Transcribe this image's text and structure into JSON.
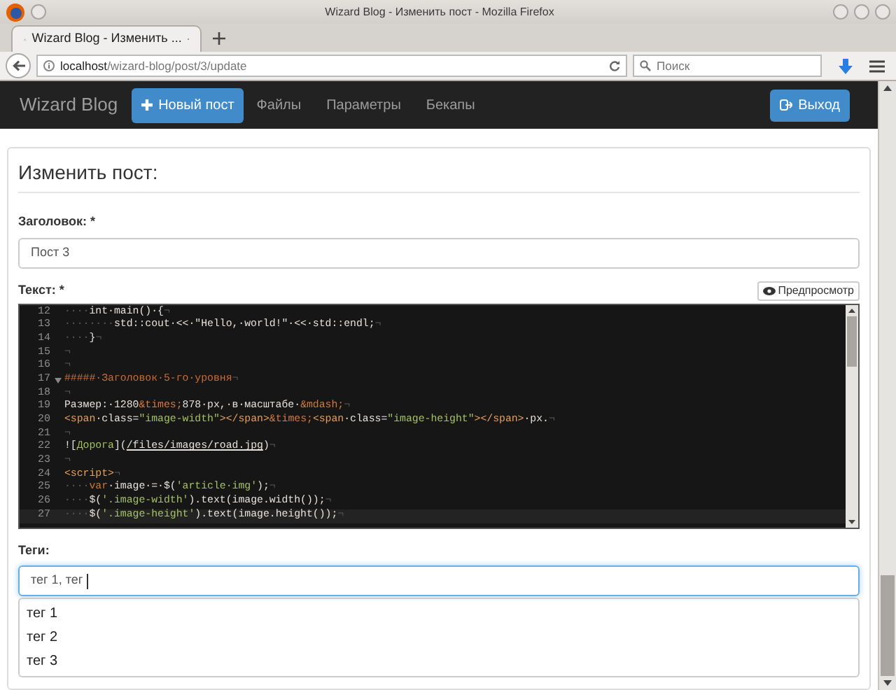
{
  "window": {
    "title": "Wizard Blog - Изменить пост - Mozilla Firefox"
  },
  "browser": {
    "tabs": [
      {
        "label": "Wizard Blog - Изменить ...",
        "selected": true
      }
    ],
    "url": {
      "host": "localhost",
      "path": "/wizard-blog/post/3/update"
    },
    "search": {
      "placeholder": "Поиск"
    }
  },
  "navbar": {
    "brand": "Wizard Blog",
    "new_post_button": "Новый пост",
    "links": [
      {
        "label": "Файлы",
        "selected": false
      },
      {
        "label": "Параметры",
        "selected": false
      },
      {
        "label": "Бекапы",
        "selected": false
      }
    ],
    "logout_button": "Выход"
  },
  "form": {
    "heading": "Изменить пост:",
    "title_label": "Заголовок: *",
    "title_value": "Пост 3",
    "text_label": "Текст: *",
    "preview_button": "Предпросмотр",
    "editor": {
      "lines": [
        {
          "number": "12",
          "active": false,
          "fold": false,
          "tokens": [
            {
              "text": "····",
              "kind": "ws"
            },
            {
              "text": "int·main()·{",
              "kind": "plain"
            },
            {
              "text": "¬",
              "kind": "ws"
            }
          ]
        },
        {
          "number": "13",
          "active": false,
          "fold": false,
          "tokens": [
            {
              "text": "········",
              "kind": "ws"
            },
            {
              "text": "std::cout·<<·\"Hello,·world!\"·<<·std::endl;",
              "kind": "plain"
            },
            {
              "text": "¬",
              "kind": "ws"
            }
          ]
        },
        {
          "number": "14",
          "active": false,
          "fold": false,
          "tokens": [
            {
              "text": "····",
              "kind": "ws"
            },
            {
              "text": "}",
              "kind": "plain"
            },
            {
              "text": "¬",
              "kind": "ws"
            }
          ]
        },
        {
          "number": "15",
          "active": false,
          "fold": false,
          "tokens": [
            {
              "text": "¬",
              "kind": "ws"
            }
          ]
        },
        {
          "number": "16",
          "active": false,
          "fold": false,
          "tokens": [
            {
              "text": "¬",
              "kind": "ws"
            }
          ]
        },
        {
          "number": "17",
          "active": false,
          "fold": true,
          "tokens": [
            {
              "text": "#####·Заголовок·5-го·уровня",
              "kind": "heading"
            },
            {
              "text": "¬",
              "kind": "ws"
            }
          ]
        },
        {
          "number": "18",
          "active": false,
          "fold": false,
          "tokens": [
            {
              "text": "¬",
              "kind": "ws"
            }
          ]
        },
        {
          "number": "19",
          "active": false,
          "fold": false,
          "tokens": [
            {
              "text": "Размер:·1280",
              "kind": "plain"
            },
            {
              "text": "&times;",
              "kind": "entity"
            },
            {
              "text": "878·px,·в·масштабе·",
              "kind": "plain"
            },
            {
              "text": "&mdash;",
              "kind": "entity"
            },
            {
              "text": "¬",
              "kind": "ws"
            }
          ]
        },
        {
          "number": "20",
          "active": false,
          "fold": false,
          "tokens": [
            {
              "text": "<span",
              "kind": "tag"
            },
            {
              "text": "·class=",
              "kind": "plain"
            },
            {
              "text": "\"image-width\"",
              "kind": "string"
            },
            {
              "text": "></span>",
              "kind": "tag"
            },
            {
              "text": "&times;",
              "kind": "entity"
            },
            {
              "text": "<span",
              "kind": "tag"
            },
            {
              "text": "·class=",
              "kind": "plain"
            },
            {
              "text": "\"image-height\"",
              "kind": "string"
            },
            {
              "text": "></span>",
              "kind": "tag"
            },
            {
              "text": "·px.",
              "kind": "plain"
            },
            {
              "text": "¬",
              "kind": "ws"
            }
          ]
        },
        {
          "number": "21",
          "active": false,
          "fold": false,
          "tokens": [
            {
              "text": "¬",
              "kind": "ws"
            }
          ]
        },
        {
          "number": "22",
          "active": false,
          "fold": false,
          "tokens": [
            {
              "text": "![",
              "kind": "plain"
            },
            {
              "text": "Дорога",
              "kind": "link"
            },
            {
              "text": "](",
              "kind": "plain"
            },
            {
              "text": "/files/images/road.jpg",
              "kind": "url"
            },
            {
              "text": ")",
              "kind": "plain"
            },
            {
              "text": "¬",
              "kind": "ws"
            }
          ]
        },
        {
          "number": "23",
          "active": false,
          "fold": false,
          "tokens": [
            {
              "text": "¬",
              "kind": "ws"
            }
          ]
        },
        {
          "number": "24",
          "active": false,
          "fold": false,
          "tokens": [
            {
              "text": "<script>",
              "kind": "tag"
            },
            {
              "text": "¬",
              "kind": "ws"
            }
          ]
        },
        {
          "number": "25",
          "active": false,
          "fold": false,
          "tokens": [
            {
              "text": "····",
              "kind": "ws"
            },
            {
              "text": "var",
              "kind": "keyword"
            },
            {
              "text": "·image·=·$(",
              "kind": "plain"
            },
            {
              "text": "'article·img'",
              "kind": "string"
            },
            {
              "text": ");",
              "kind": "plain"
            },
            {
              "text": "¬",
              "kind": "ws"
            }
          ]
        },
        {
          "number": "26",
          "active": false,
          "fold": false,
          "tokens": [
            {
              "text": "····",
              "kind": "ws"
            },
            {
              "text": "$(",
              "kind": "plain"
            },
            {
              "text": "'.image-width'",
              "kind": "string"
            },
            {
              "text": ").text(image.width());",
              "kind": "plain"
            },
            {
              "text": "¬",
              "kind": "ws"
            }
          ]
        },
        {
          "number": "27",
          "active": true,
          "fold": false,
          "tokens": [
            {
              "text": "····",
              "kind": "ws"
            },
            {
              "text": "$(",
              "kind": "plain"
            },
            {
              "text": "'.image-height'",
              "kind": "string"
            },
            {
              "text": ").text(image.height());",
              "kind": "plain"
            },
            {
              "text": "¬",
              "kind": "ws"
            }
          ]
        }
      ]
    },
    "tags_label": "Теги:",
    "tags_value": "тег 1, тег ",
    "suggestions": [
      {
        "label": "тег 1",
        "selected": false
      },
      {
        "label": "тег 2",
        "selected": false
      },
      {
        "label": "тег 3",
        "selected": false
      }
    ]
  }
}
